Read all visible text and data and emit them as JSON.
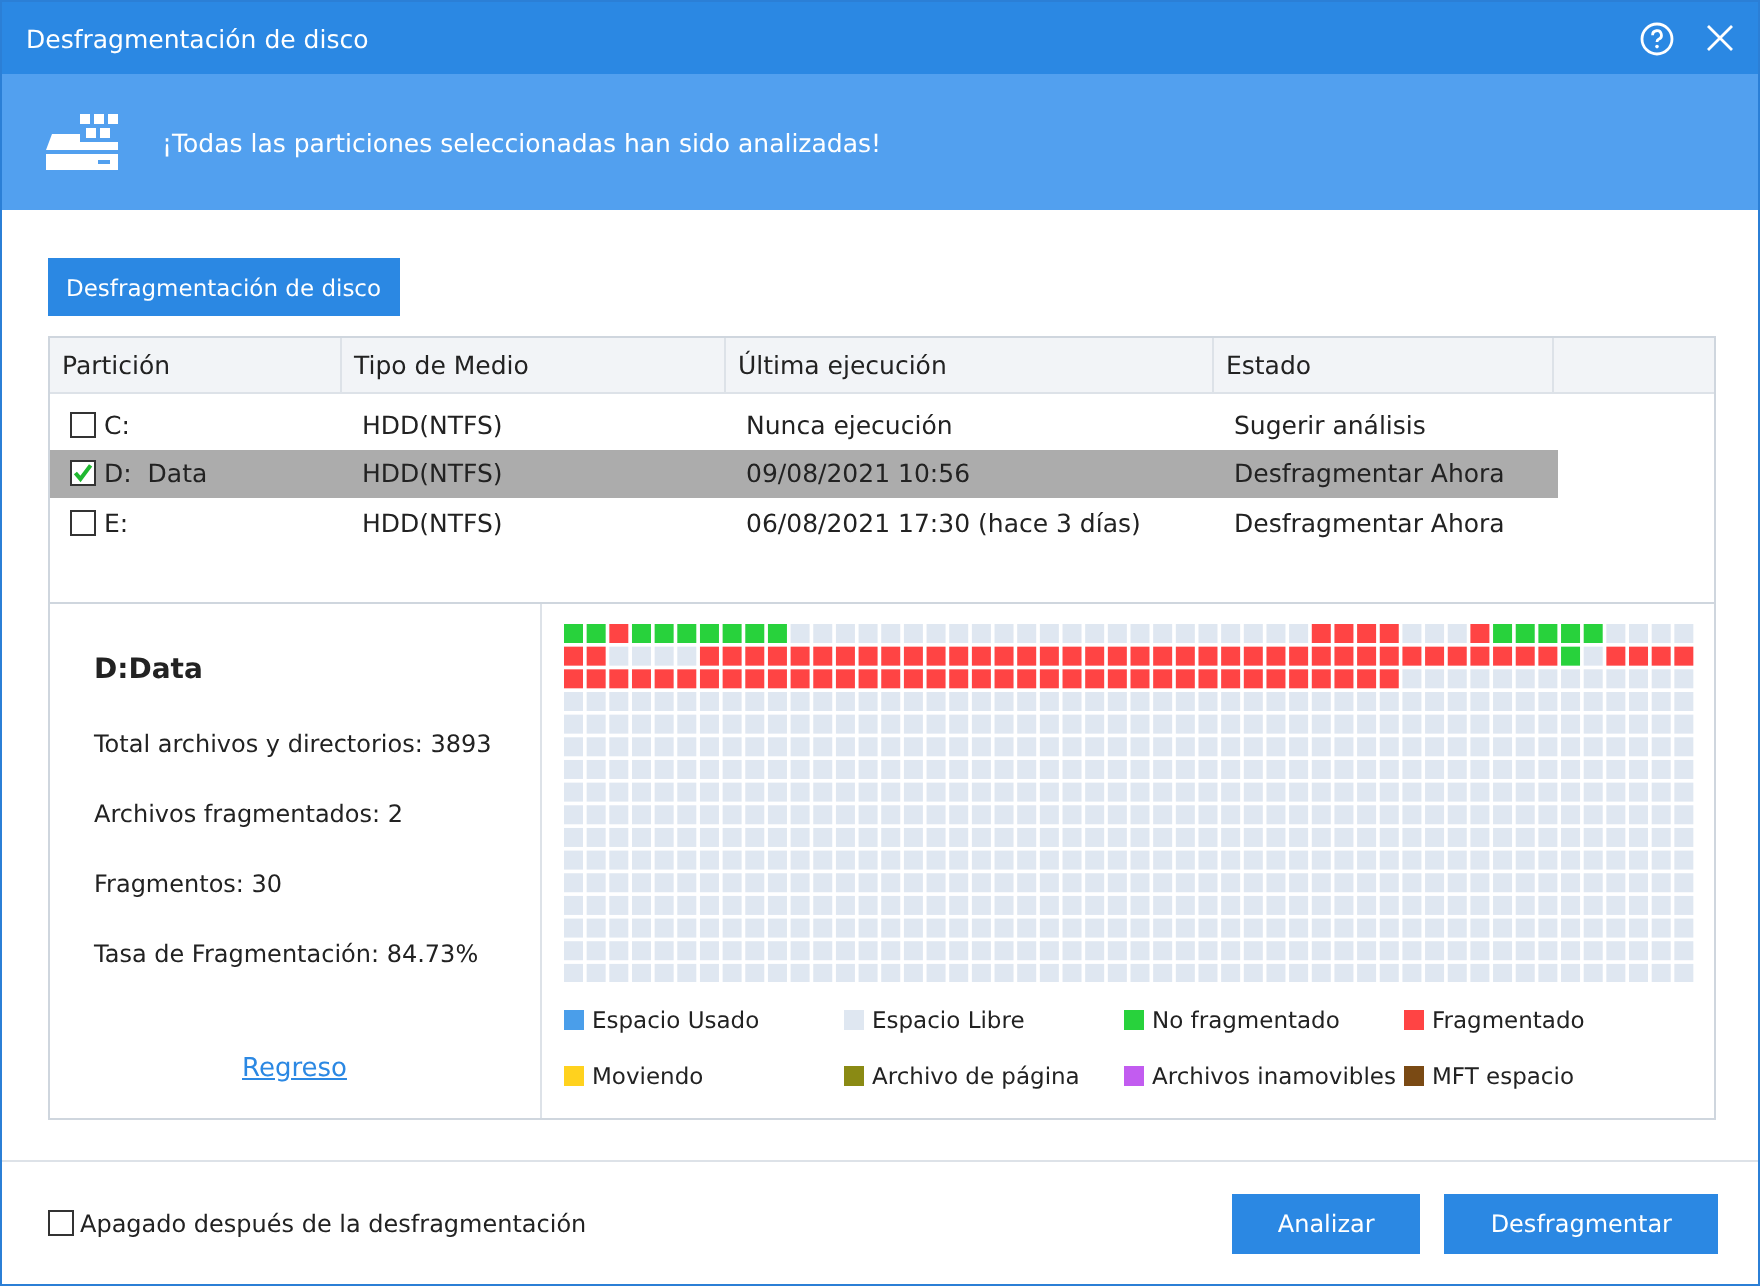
{
  "window": {
    "title": "Desfragmentación de disco"
  },
  "banner": {
    "message": "¡Todas las particiones seleccionadas han sido analizadas!"
  },
  "tab": {
    "label": "Desfragmentación de disco"
  },
  "table": {
    "columns": [
      "Partición",
      "Tipo de Medio",
      "Última ejecución",
      "Estado"
    ],
    "rows": [
      {
        "partition": "C:",
        "media": "HDD(NTFS)",
        "last_run": "Nunca ejecución",
        "status": "Sugerir análisis",
        "checked": false,
        "selected": false
      },
      {
        "partition": "D:  Data",
        "media": "HDD(NTFS)",
        "last_run": "09/08/2021 10:56",
        "status": "Desfragmentar Ahora",
        "checked": true,
        "selected": true
      },
      {
        "partition": "E:",
        "media": "HDD(NTFS)",
        "last_run": "06/08/2021 17:30 (hace 3 días)",
        "status": "Desfragmentar Ahora",
        "checked": false,
        "selected": false
      }
    ]
  },
  "details": {
    "title": "D:Data",
    "stats": [
      "Total archivos y directorios: 3893",
      "Archivos fragmentados: 2",
      "Fragmentos: 30",
      "Tasa de Fragmentación: 84.73%"
    ],
    "back_link": "Regreso"
  },
  "legend": [
    {
      "label": "Espacio Usado",
      "color": "#4a9eea"
    },
    {
      "label": "Espacio Libre",
      "color": "#dfe7f1"
    },
    {
      "label": "No fragmentado",
      "color": "#28d23c"
    },
    {
      "label": "Fragmentado",
      "color": "#ff4444"
    },
    {
      "label": "Moviendo",
      "color": "#ffd21e"
    },
    {
      "label": "Archivo de página",
      "color": "#8a8a14"
    },
    {
      "label": "Archivos inamovibles",
      "color": "#c25cf0"
    },
    {
      "label": "MFT espacio",
      "color": "#7a4a14"
    }
  ],
  "footer": {
    "shutdown": {
      "label": "Apagado después de la desfragmentación",
      "checked": false
    },
    "buttons": [
      "Analizar",
      "Desfragmentar"
    ]
  }
}
